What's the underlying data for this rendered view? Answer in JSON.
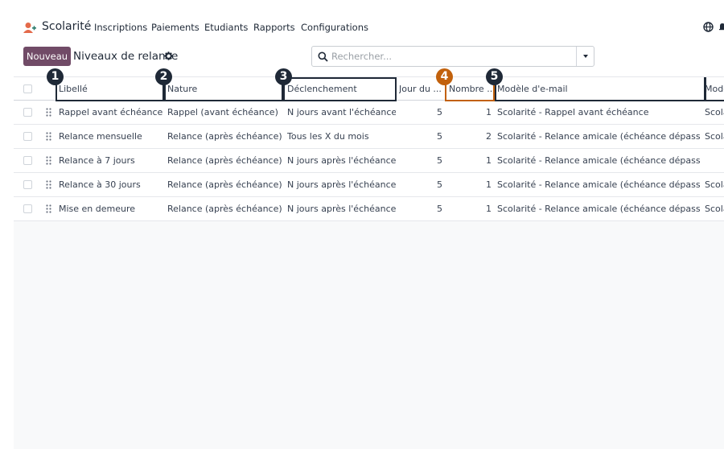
{
  "app": {
    "name": "Scolarité",
    "icon": "person-plus-icon"
  },
  "menu": [
    "Inscriptions",
    "Paiements",
    "Etudiants",
    "Rapports",
    "Configurations"
  ],
  "systray": {
    "globe": "globe-icon",
    "extra": "bell-icon"
  },
  "control_panel": {
    "new_button": "Nouveau",
    "title": "Niveaux de relance",
    "search_placeholder": "Rechercher..."
  },
  "columns": [
    "Libellé",
    "Nature",
    "Déclenchement",
    "Jour du ...",
    "Nombre ...",
    "Modèle d'e-mail",
    "Modè"
  ],
  "rows": [
    {
      "libelle": "Rappel avant échéance",
      "nature": "Rappel (avant échéance)",
      "declenchement": "N jours avant l'échéance",
      "jour": "5",
      "nombre": "1",
      "modele": "Scolarité - Rappel avant échéance",
      "extra": "Scola"
    },
    {
      "libelle": "Relance mensuelle",
      "nature": "Relance (après échéance)",
      "declenchement": "Tous les X du mois",
      "jour": "5",
      "nombre": "2",
      "modele": "Scolarité - Relance amicale (échéance dépassée)",
      "extra": "Scola"
    },
    {
      "libelle": "Relance à 7 jours",
      "nature": "Relance (après échéance)",
      "declenchement": "N jours après l'échéance",
      "jour": "5",
      "nombre": "1",
      "modele": "Scolarité - Relance amicale (échéance dépassée)",
      "extra": ""
    },
    {
      "libelle": "Relance à 30 jours",
      "nature": "Relance (après échéance)",
      "declenchement": "N jours après l'échéance",
      "jour": "5",
      "nombre": "1",
      "modele": "Scolarité - Relance amicale (échéance dépassée)",
      "extra": "Scola"
    },
    {
      "libelle": "Mise en demeure",
      "nature": "Relance (après échéance)",
      "declenchement": "N jours après l'échéance",
      "jour": "5",
      "nombre": "1",
      "modele": "Scolarité - Relance amicale (échéance dépassée)",
      "extra": "Scola"
    }
  ],
  "markers": [
    "1",
    "2",
    "3",
    "4",
    "5"
  ],
  "colors": {
    "brand": "#714b67",
    "marker_dark": "#1f2937",
    "marker_orange": "#c2610c"
  }
}
